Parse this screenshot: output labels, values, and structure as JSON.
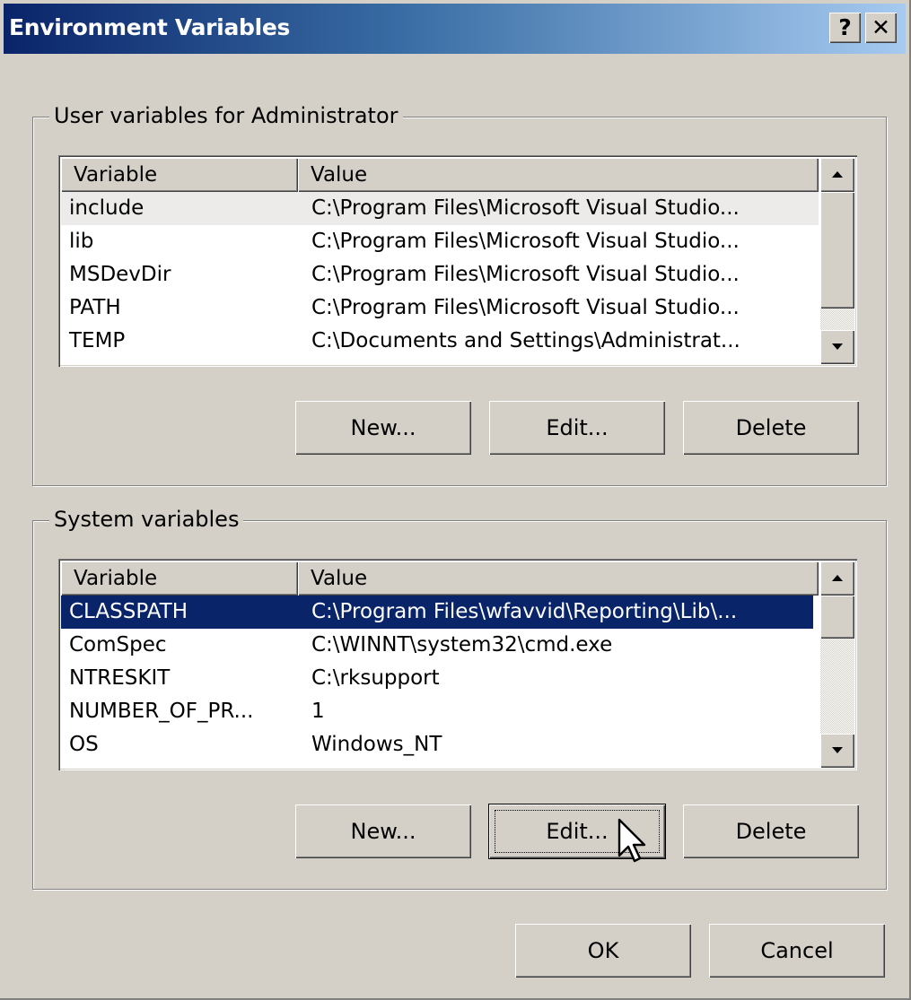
{
  "window": {
    "title": "Environment Variables",
    "help_glyph": "?",
    "close_glyph": "✕"
  },
  "user_vars": {
    "group_label": "User variables for Administrator",
    "columns": [
      "Variable",
      "Value"
    ],
    "rows": [
      {
        "variable": "include",
        "value": "C:\\Program Files\\Microsoft Visual Studio..."
      },
      {
        "variable": "lib",
        "value": "C:\\Program Files\\Microsoft Visual Studio..."
      },
      {
        "variable": "MSDevDir",
        "value": "C:\\Program Files\\Microsoft Visual Studio..."
      },
      {
        "variable": "PATH",
        "value": "C:\\Program Files\\Microsoft Visual Studio..."
      },
      {
        "variable": "TEMP",
        "value": "C:\\Documents and Settings\\Administrat..."
      }
    ],
    "buttons": {
      "new": "New...",
      "edit": "Edit...",
      "delete": "Delete"
    }
  },
  "system_vars": {
    "group_label": "System variables",
    "columns": [
      "Variable",
      "Value"
    ],
    "rows": [
      {
        "variable": "CLASSPATH",
        "value": "C:\\Program Files\\wfavvid\\Reporting\\Lib\\..."
      },
      {
        "variable": "ComSpec",
        "value": "C:\\WINNT\\system32\\cmd.exe"
      },
      {
        "variable": "NTRESKIT",
        "value": "C:\\rksupport"
      },
      {
        "variable": "NUMBER_OF_PR...",
        "value": "1"
      },
      {
        "variable": "OS",
        "value": "Windows_NT"
      }
    ],
    "selected_row": "CLASSPATH",
    "buttons": {
      "new": "New...",
      "edit": "Edit...",
      "delete": "Delete"
    }
  },
  "footer": {
    "ok": "OK",
    "cancel": "Cancel"
  },
  "colors": {
    "selection": "#0a246a",
    "face": "#d4d0c8",
    "title_start": "#0a246a",
    "title_end": "#a6caf0"
  }
}
